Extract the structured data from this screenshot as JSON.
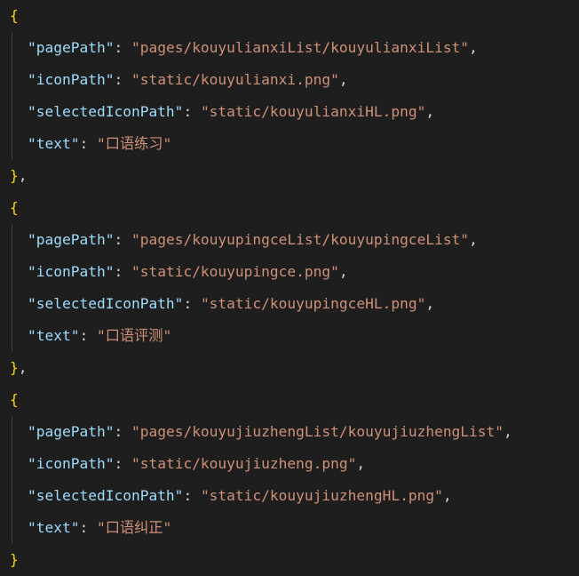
{
  "theme": {
    "background": "#1e1e1e",
    "key_color": "#9cdcfe",
    "string_color": "#ce9178",
    "brace_color": "#ffd700",
    "punctuation_color": "#d4d4d4",
    "indent_guide_color": "#404040"
  },
  "editor": {
    "open_brace": "{",
    "close_brace": "}",
    "close_brace_comma": "},",
    "colon": ": ",
    "comma": ",",
    "keys": {
      "page_path": "\"pagePath\"",
      "icon_path": "\"iconPath\"",
      "selected_icon_path": "\"selectedIconPath\"",
      "text": "\"text\""
    },
    "tab_items": [
      {
        "page_path": "\"pages/kouyulianxiList/kouyulianxiList\"",
        "icon_path": "\"static/kouyulianxi.png\"",
        "selected_icon_path": "\"static/kouyulianxiHL.png\"",
        "text": "\"口语练习\""
      },
      {
        "page_path": "\"pages/kouyupingceList/kouyupingceList\"",
        "icon_path": "\"static/kouyupingce.png\"",
        "selected_icon_path": "\"static/kouyupingceHL.png\"",
        "text": "\"口语评测\""
      },
      {
        "page_path": "\"pages/kouyujiuzhengList/kouyujiuzhengList\"",
        "icon_path": "\"static/kouyujiuzheng.png\"",
        "selected_icon_path": "\"static/kouyujiuzhengHL.png\"",
        "text": "\"口语纠正\""
      }
    ]
  }
}
